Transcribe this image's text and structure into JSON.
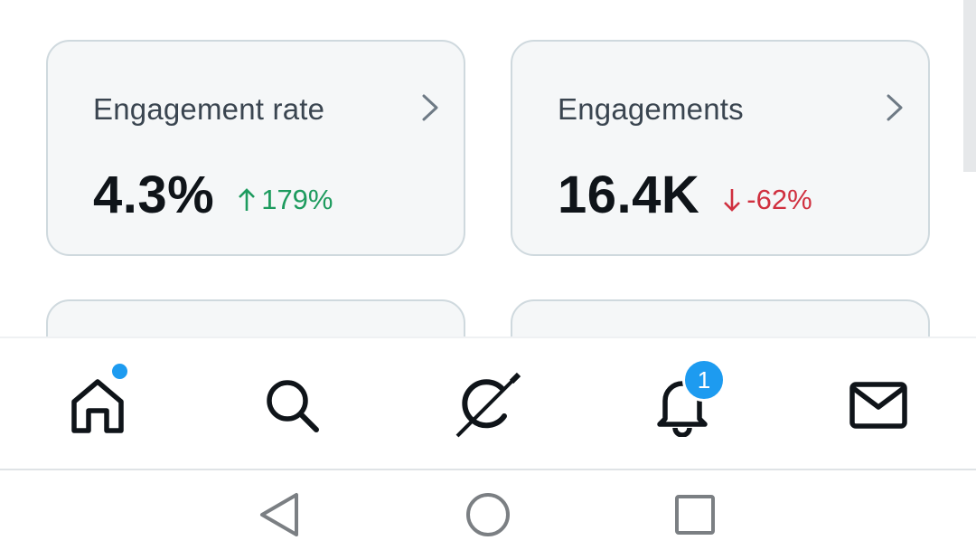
{
  "cards": [
    {
      "title": "Engagement rate",
      "value": "4.3%",
      "change": "179%",
      "trend": "up"
    },
    {
      "title": "Engagements",
      "value": "16.4K",
      "change": "-62%",
      "trend": "down"
    }
  ],
  "bottom_nav": {
    "items": [
      "home-icon",
      "search-icon",
      "grok-icon",
      "bell-icon",
      "mail-icon"
    ],
    "notification_count": "1"
  },
  "system_nav": {
    "items": [
      "back-icon",
      "home-circle-icon",
      "recents-icon"
    ]
  },
  "colors": {
    "positive": "#1d9b5e",
    "negative": "#d0303f",
    "accent": "#1d9bf0",
    "card_bg": "#f5f7f8"
  }
}
